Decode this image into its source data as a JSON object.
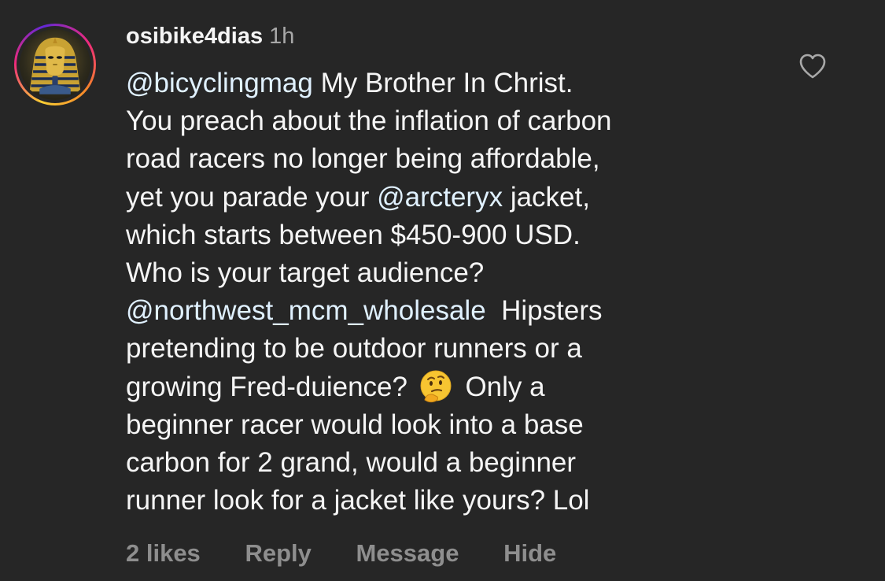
{
  "comment": {
    "username": "osibike4dias",
    "timestamp": "1h",
    "lines": [
      {
        "parts": [
          {
            "m": "@bicyclingmag"
          },
          {
            "t": " My Brother In Christ."
          }
        ]
      },
      {
        "parts": [
          {
            "t": "You preach about the inflation of carbon"
          }
        ]
      },
      {
        "parts": [
          {
            "t": "road racers no longer being affordable,"
          }
        ]
      },
      {
        "parts": [
          {
            "t": "yet you parade your "
          },
          {
            "m": "@arcteryx"
          },
          {
            "t": " jacket,"
          }
        ]
      },
      {
        "parts": [
          {
            "t": "which starts between $450-900 USD."
          }
        ]
      },
      {
        "parts": [
          {
            "t": "Who is your target audience?"
          }
        ]
      },
      {
        "parts": [
          {
            "m": "@northwest_mcm_wholesale"
          },
          {
            "t": "  Hipsters"
          }
        ]
      },
      {
        "parts": [
          {
            "t": "pretending to be outdoor runners or a"
          }
        ]
      },
      {
        "parts": [
          {
            "t": "growing Fred-duience? "
          },
          {
            "e": "thinking-face-emoji"
          },
          {
            "t": " Only a"
          }
        ]
      },
      {
        "parts": [
          {
            "t": "beginner racer would look into a base"
          }
        ]
      },
      {
        "parts": [
          {
            "t": "carbon for 2 grand, would a beginner"
          }
        ]
      },
      {
        "parts": [
          {
            "t": "runner look for a jacket like yours? Lol"
          }
        ]
      }
    ],
    "likes": "2 likes",
    "reply_label": "Reply",
    "message_label": "Message",
    "hide_label": "Hide"
  },
  "icons": {
    "like": "heart-outline-icon",
    "avatar": "pharaoh-mask-avatar"
  },
  "colors": {
    "background": "#262626",
    "text": "#f5f5f5",
    "mention": "#e0f1ff",
    "secondary": "#8e8e8e",
    "timestamp": "#a8a8a8"
  }
}
